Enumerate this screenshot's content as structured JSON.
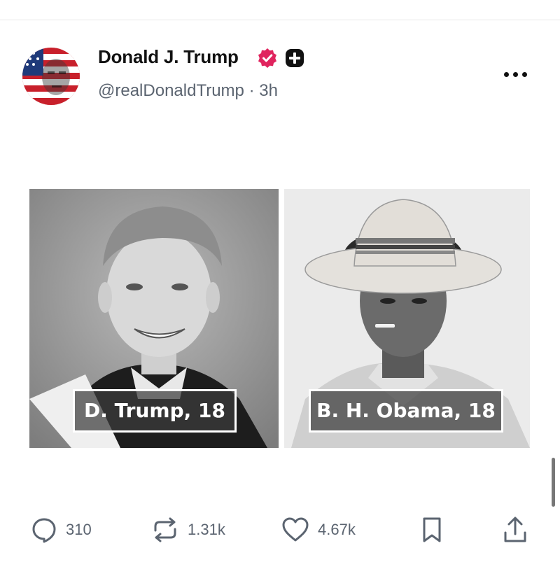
{
  "post": {
    "display_name": "Donald J. Trump",
    "handle": "@realDonaldTrump",
    "time": "· 3h",
    "verified_badge_color": "#e0245e",
    "images": [
      {
        "caption": "D. Trump, 18"
      },
      {
        "caption": "B. H. Obama, 18"
      }
    ]
  },
  "actions": {
    "replies": "310",
    "reposts": "1.31k",
    "likes": "4.67k"
  },
  "icons": [
    "verified-icon",
    "subscribe-plus-icon",
    "more-options-icon",
    "reply-icon",
    "repost-icon",
    "like-icon",
    "bookmark-icon",
    "share-icon"
  ]
}
